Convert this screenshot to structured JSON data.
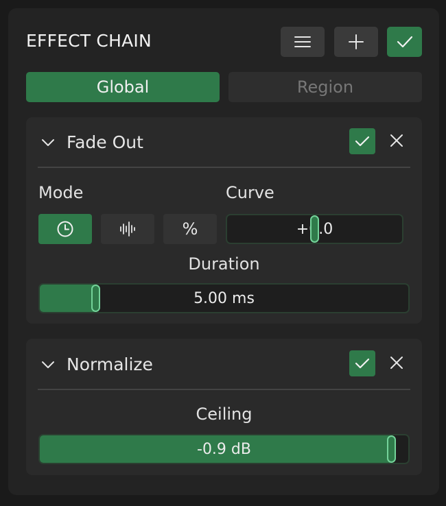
{
  "header": {
    "title": "EFFECT CHAIN",
    "menu_icon": "hamburger-menu-icon",
    "add_icon": "plus-icon",
    "enable_icon": "checkmark-icon"
  },
  "tabs": [
    {
      "label": "Global",
      "active": true
    },
    {
      "label": "Region",
      "active": false
    }
  ],
  "effects": {
    "fade_out": {
      "title": "Fade Out",
      "enabled": true,
      "mode_label": "Mode",
      "mode_options": [
        "clock-icon",
        "waveform-icon",
        "%"
      ],
      "mode_selected": 0,
      "curve_label": "Curve",
      "curve_value": "+0.0",
      "duration_label": "Duration",
      "duration_value": "5.00 ms",
      "duration_fraction": 0.15
    },
    "normalize": {
      "title": "Normalize",
      "enabled": true,
      "ceiling_label": "Ceiling",
      "ceiling_value": "-0.9 dB",
      "ceiling_fraction": 0.955
    }
  },
  "colors": {
    "accent": "#2f7a4a",
    "handle": "#74d39a",
    "panel": "#232323",
    "card": "#2a2a2a"
  }
}
